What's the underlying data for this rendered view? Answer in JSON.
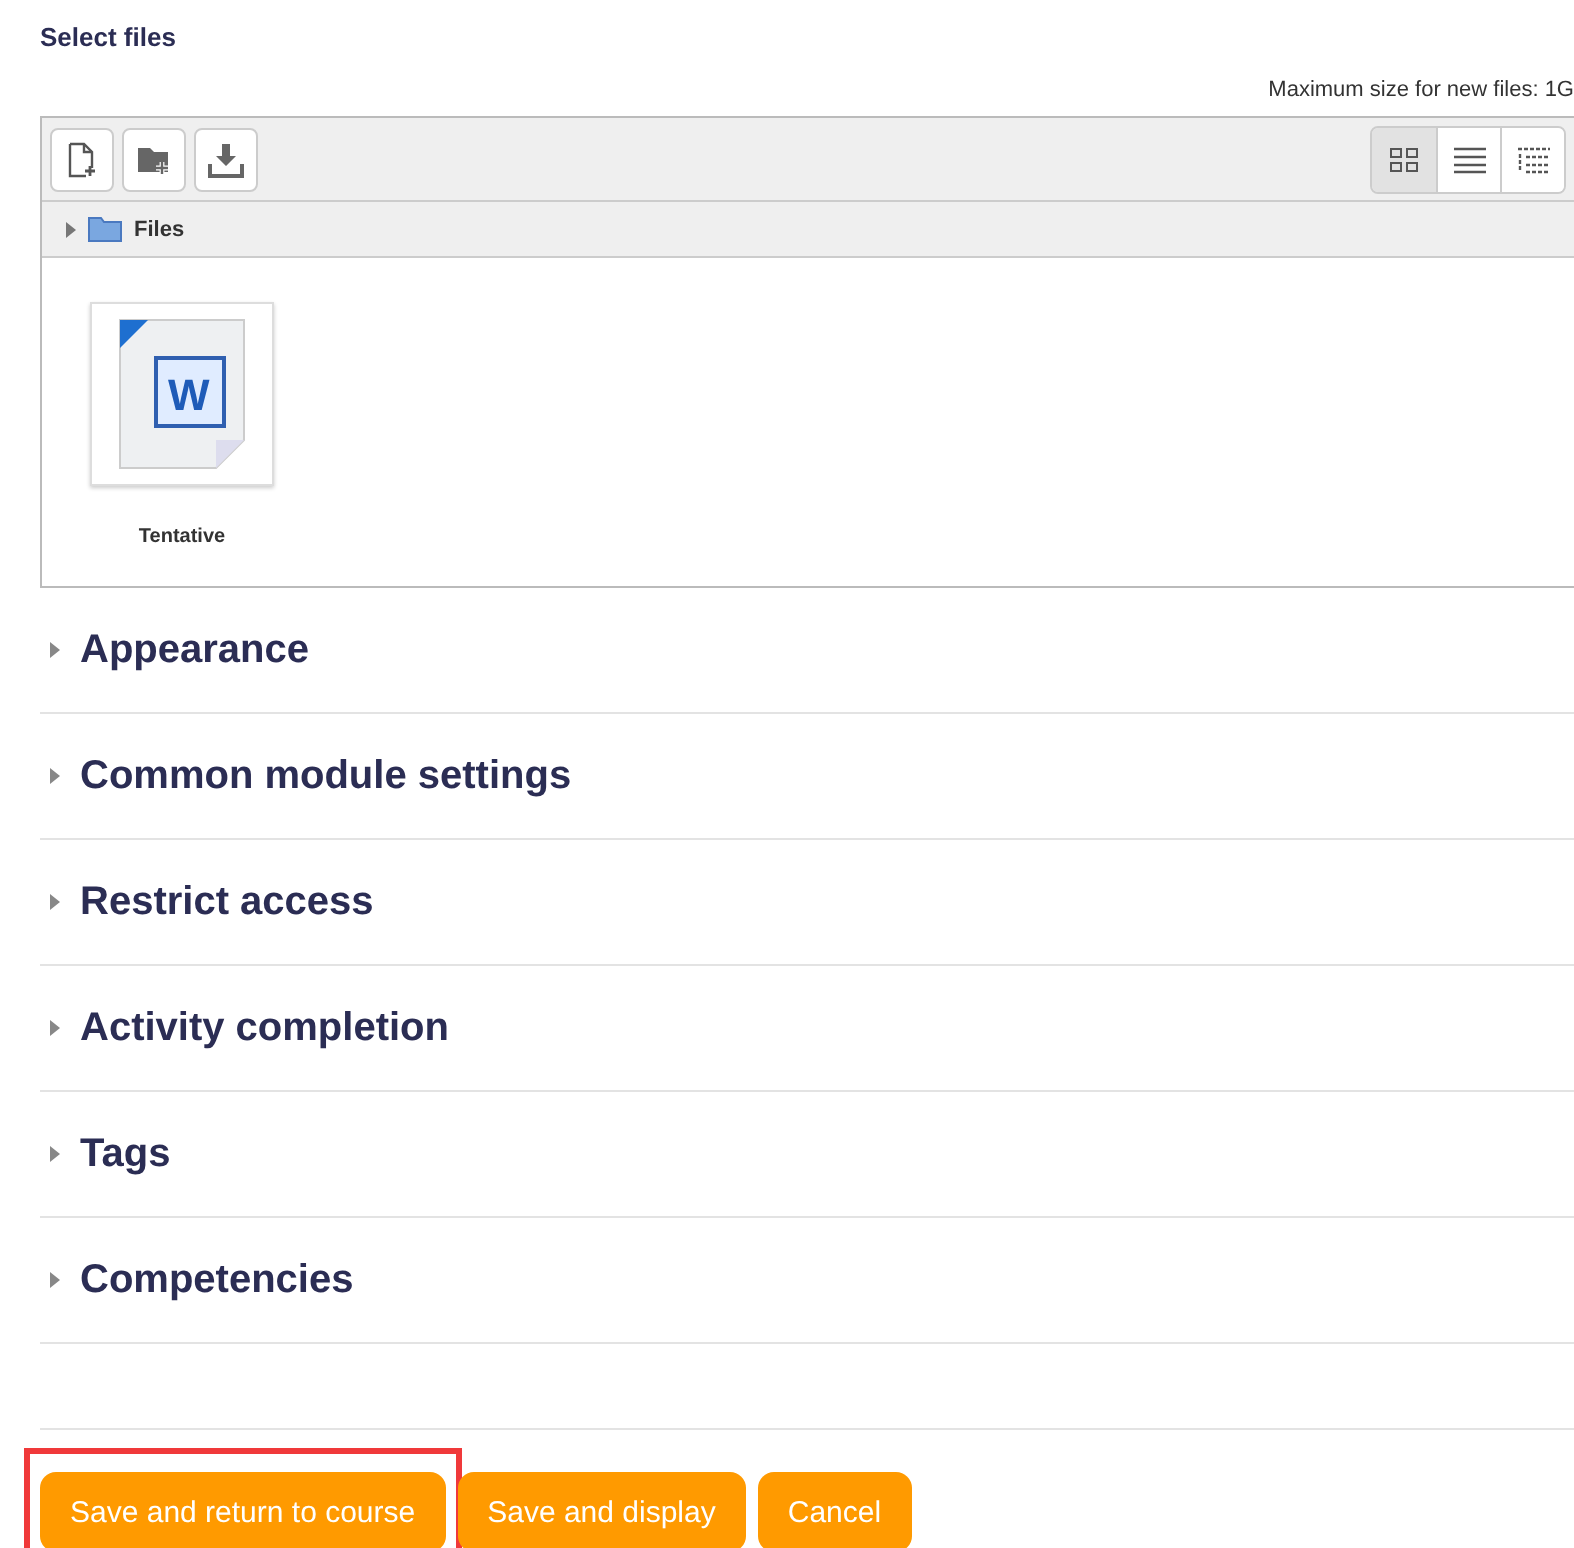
{
  "title": "Select files",
  "max_size": "Maximum size for new files: 1G",
  "toolbar_left": [
    {
      "kind": "add-file"
    },
    {
      "kind": "add-folder"
    },
    {
      "kind": "download"
    }
  ],
  "view_modes": [
    {
      "kind": "icons",
      "selected": true
    },
    {
      "kind": "list",
      "selected": false
    },
    {
      "kind": "tree",
      "selected": false
    }
  ],
  "path": "Files",
  "files": [
    {
      "name": "Tentative",
      "icon_glyph": "W"
    }
  ],
  "sections": [
    {
      "label": "Appearance",
      "expanded": false
    },
    {
      "label": "Common module settings",
      "expanded": false
    },
    {
      "label": "Restrict access",
      "expanded": false
    },
    {
      "label": "Activity completion",
      "expanded": false
    },
    {
      "label": "Tags",
      "expanded": false
    },
    {
      "label": "Competencies",
      "expanded": false
    }
  ],
  "buttons": [
    {
      "label": "Save and return to course",
      "highlighted": true
    },
    {
      "label": "Save and display",
      "highlighted": false
    },
    {
      "label": "Cancel",
      "highlighted": false
    }
  ]
}
